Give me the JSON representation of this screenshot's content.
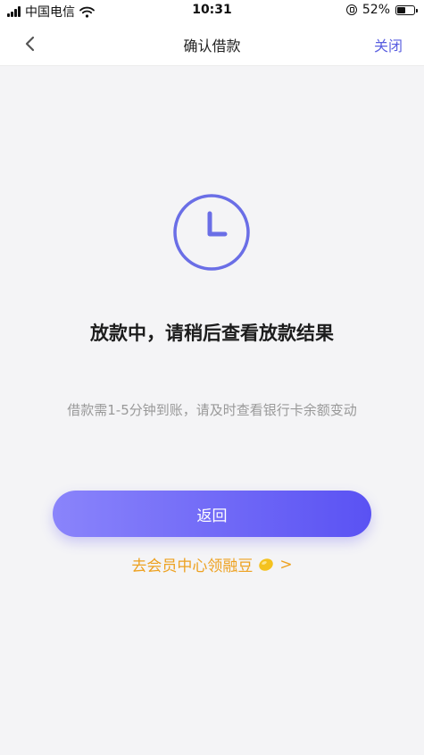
{
  "status_bar": {
    "carrier": "中国电信",
    "time": "10:31",
    "battery": "52%",
    "battery_level": 0.52
  },
  "nav": {
    "title": "确认借款",
    "close_label": "关闭",
    "back_icon": "chevron-left-icon"
  },
  "main": {
    "status_icon": "clock-icon",
    "title": "放款中，请稍后查看放款结果",
    "description": "借款需1-5分钟到账，请及时查看银行卡余额变动",
    "return_button": "返回",
    "member_link": "去会员中心领融豆",
    "member_link_arrow": ">",
    "bean_icon": "bean-icon"
  },
  "colors": {
    "accent": "#5a5fe0",
    "button_gradient_start": "#8a84fb",
    "button_gradient_end": "#5a52f3",
    "link": "#eda120",
    "background": "#f4f4f6"
  }
}
